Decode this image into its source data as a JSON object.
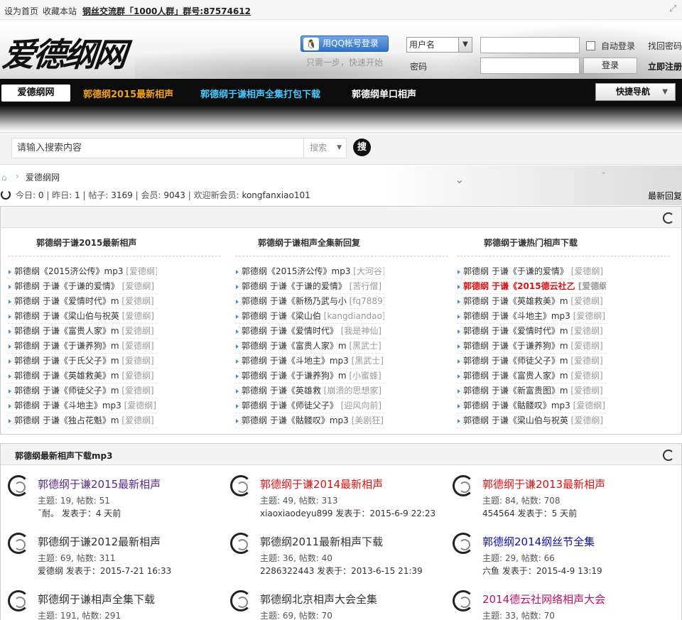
{
  "topbar": {
    "set_home": "设为首页",
    "bookmark": "收藏本站",
    "qq_group": "钢丝交流群「1000人群」群号:87574612",
    "fullscreen_icon": "expand-icon"
  },
  "header": {
    "logo": "爱德纲网",
    "qq_login": "用QQ帐号登录",
    "qq_hint": "只需一步，快速开始",
    "username_select": "用户名",
    "password_label": "密码",
    "auto_login": "自动登录",
    "login_button": "登录",
    "find_password": "找回密码",
    "register": "立即注册"
  },
  "nav": {
    "home": "爱德纲网",
    "items": [
      "郭德纲2015最新相声",
      "郭德纲于谦相声全集打包下载",
      "郭德纲单口相声"
    ],
    "item_colors": [
      "#f0a020",
      "#49c9ff",
      "#ffffff"
    ],
    "quick_nav": "快捷导航"
  },
  "search": {
    "placeholder": "请输入搜索内容",
    "type": "搜索",
    "button": "搜"
  },
  "breadcrumb": {
    "current": "爱德纲网"
  },
  "stats": {
    "today_label": "今日:",
    "today": "0",
    "yesterday_label": "昨日:",
    "yesterday": "1",
    "posts_label": "帖子:",
    "posts": "3169",
    "members_label": "会员:",
    "members": "9043",
    "welcome_label": "欢迎新会员:",
    "newest_member": "kongfanxiao101",
    "latest_reply": "最新回复"
  },
  "columns": [
    {
      "title": "郭德纲于谦2015最新相声",
      "items": [
        {
          "t": "郭德纲《2015济公传》mp3",
          "a": "[爱德纲]"
        },
        {
          "t": "郭德纲 于谦《于谦的爱情》",
          "a": "[爱德纲]"
        },
        {
          "t": "郭德纲 于谦《爱情时代》m",
          "a": "[爱德纲]"
        },
        {
          "t": "郭德纲 于谦《梁山伯与祝英",
          "a": "[爱德纲]"
        },
        {
          "t": "郭德纲 于谦《富贵人家》m",
          "a": "[爱德纲]"
        },
        {
          "t": "郭德纲 于谦《于谦养狗》m",
          "a": "[爱德纲]"
        },
        {
          "t": "郭德纲 于谦《于氏父子》m",
          "a": "[爱德纲]"
        },
        {
          "t": "郭德纲 于谦《英雄救美》m",
          "a": "[爱德纲]"
        },
        {
          "t": "郭德纲 于谦《师徒父子》m",
          "a": "[爱德纲]"
        },
        {
          "t": "郭德纲 于谦《斗地主》mp3",
          "a": "[爱德纲]"
        },
        {
          "t": "郭德纲 于谦《独占花魁》m",
          "a": "[爱德纲]"
        }
      ]
    },
    {
      "title": "郭德纲于谦相声全集新回复",
      "items": [
        {
          "t": "郭德纲《2015济公传》mp3",
          "a": "[大河谷]"
        },
        {
          "t": "郭德纲 于谦《于谦的爱情》",
          "a": "[苦行僧]"
        },
        {
          "t": "郭德纲 于谦《新杨乃武与小",
          "a": "[fq7889]"
        },
        {
          "t": "郭德纲 于谦《梁山伯",
          "a": "[kangdiandao]"
        },
        {
          "t": "郭德纲 于谦《爱情时代》",
          "a": "[我是神仙]"
        },
        {
          "t": "郭德纲 于谦《富贵人家》m",
          "a": "[黑武士]"
        },
        {
          "t": "郭德纲 于谦《斗地主》mp3",
          "a": "[黑武士]"
        },
        {
          "t": "郭德纲 于谦《于谦养狗》m",
          "a": "[小蜜蜂]"
        },
        {
          "t": "郭德纲 于谦《英雄救",
          "a": "[崩溃的思想家]"
        },
        {
          "t": "郭德纲 于谦《师徒父子》",
          "a": "[迎风向前]"
        },
        {
          "t": "郭德纲 于谦《骷髅叹》mp3",
          "a": "[美剧狂]"
        }
      ]
    },
    {
      "title": "郭德纲于谦热门相声下载",
      "items": [
        {
          "t": "郭德纲 于谦《于谦的爱情》",
          "a": "[爱德纲]"
        },
        {
          "t": "郭德纲 于谦《2015德云社乙",
          "a": "[爱德纲]",
          "hot": true
        },
        {
          "t": "郭德纲 于谦《英雄救美》m",
          "a": "[爱德纲]"
        },
        {
          "t": "郭德纲 于谦《斗地主》mp3",
          "a": "[爱德纲]"
        },
        {
          "t": "郭德纲 于谦《爱情时代》m",
          "a": "[爱德纲]"
        },
        {
          "t": "郭德纲 于谦《于谦养狗》m",
          "a": "[爱德纲]"
        },
        {
          "t": "郭德纲 于谦《师徒父子》m",
          "a": "[爱德纲]"
        },
        {
          "t": "郭德纲 于谦《富贵人家》m",
          "a": "[爱德纲]"
        },
        {
          "t": "郭德纲 于谦《新富贵图》m",
          "a": "[爱德纲]"
        },
        {
          "t": "郭德纲 于谦《骷髅叹》mp3",
          "a": "[爱德纲]"
        },
        {
          "t": "郭德纲 于谦《梁山伯与祝英",
          "a": "[爱德纲]"
        }
      ]
    }
  ],
  "forum_section": {
    "title": "郭德纲最新相声下载mp3",
    "forums": [
      {
        "name": "郭德纲于谦2015最新相声",
        "color": "#5a2a8a",
        "stats": "主题: 19, 帖数: 51",
        "last": "ˉ耐。 发表于：4 天前"
      },
      {
        "name": "郭德纲于谦2014最新相声",
        "color": "#e01010",
        "stats": "主题: 49, 帖数: 313",
        "last": "xiaoxiaodeyu899 发表于：2015-6-9 22:23"
      },
      {
        "name": "郭德纲于谦2013最新相声",
        "color": "#e01010",
        "stats": "主题: 84, 帖数: 708",
        "last": "454564 发表于：5 天前"
      },
      {
        "name": "郭德纲于谦2012最新相声",
        "color": "#333333",
        "stats": "主题: 69, 帖数: 311",
        "last": "爱德纲 发表于：2015-7-21 16:33"
      },
      {
        "name": "郭德纲2011最新相声下载",
        "color": "#333333",
        "stats": "主题: 36, 帖数: 40",
        "last": "2286322443 发表于：2013-6-15 21:39"
      },
      {
        "name": "郭德纲2014纲丝节全集",
        "color": "#1010a0",
        "stats": "主题: 29, 帖数: 66",
        "last": "六鱼 发表于：2015-4-9 13:19"
      },
      {
        "name": "郭德纲于谦相声全集下载",
        "color": "#333333",
        "stats": "主题: 191, 帖数: 291",
        "last": ""
      },
      {
        "name": "郭德纲北京相声大会全集",
        "color": "#333333",
        "stats": "主题: 69, 帖数: 70",
        "last": ""
      },
      {
        "name": "2014德云社网络相声大会",
        "color": "#c0106a",
        "stats": "主题: 33, 帖数: 70",
        "last": ""
      }
    ]
  }
}
